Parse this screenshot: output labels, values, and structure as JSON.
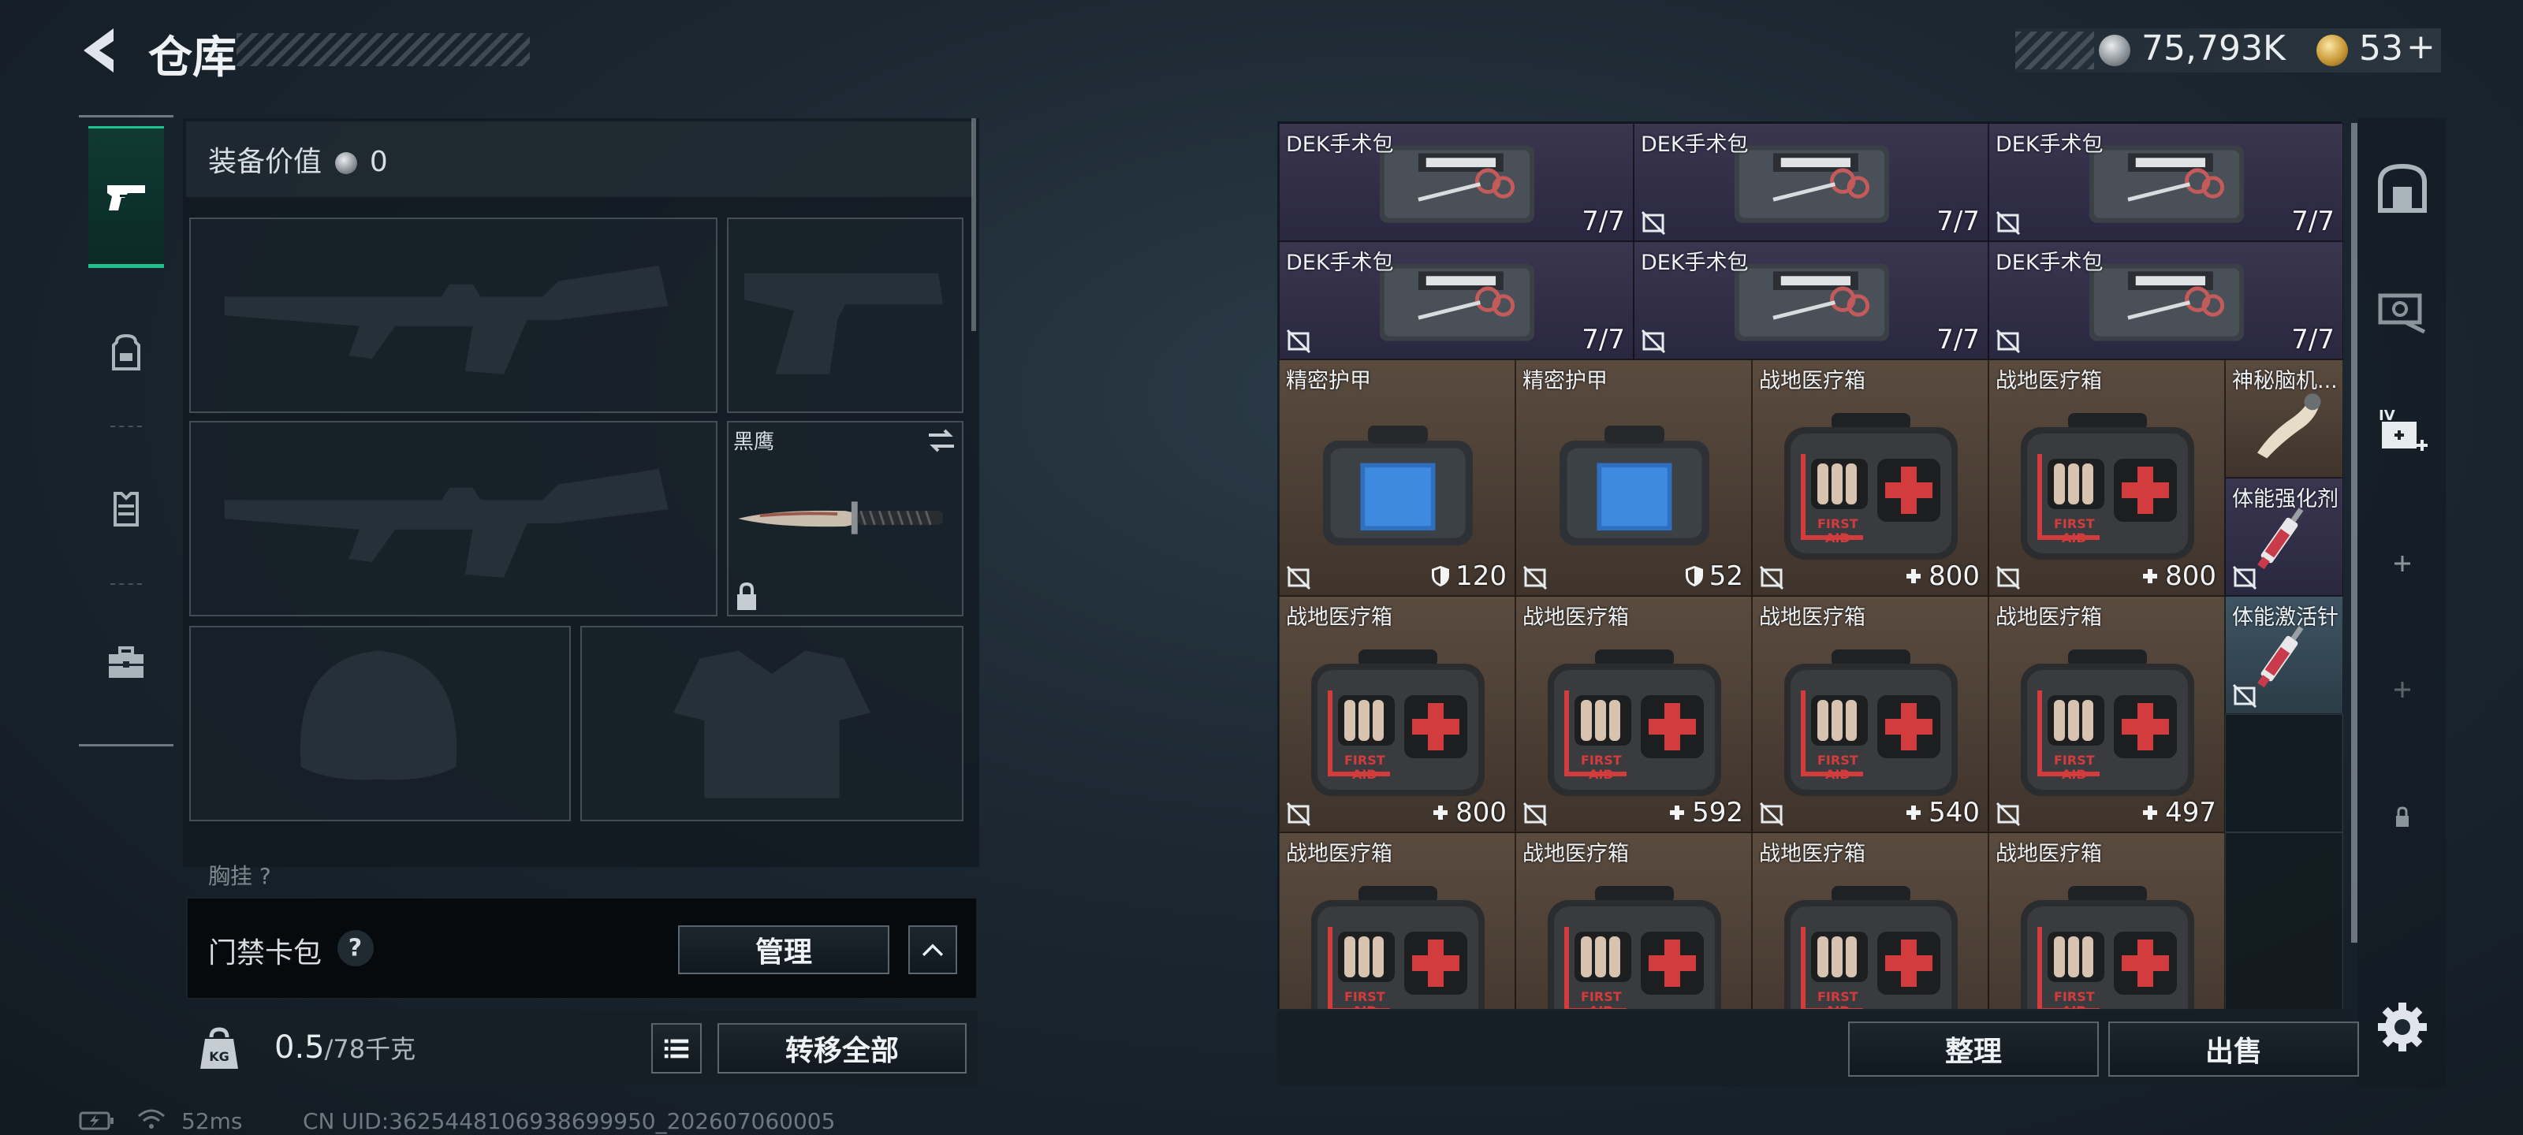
{
  "header": {
    "title": "仓库",
    "silver_amount": "75,793K",
    "gold_amount": "53",
    "gold_add": "+"
  },
  "tabs": [
    {
      "name": "weapons",
      "icon": "pistol-icon"
    },
    {
      "name": "backpack",
      "icon": "backpack-icon"
    },
    {
      "name": "vest",
      "icon": "vest-icon"
    },
    {
      "name": "case",
      "icon": "briefcase-icon"
    }
  ],
  "equipment": {
    "value_label": "装备价值",
    "value": "0",
    "knife_name": "黑鹰",
    "chest_label": "胸挂 ?"
  },
  "keycard": {
    "label": "门禁卡包",
    "help": "?",
    "manage_label": "管理"
  },
  "capacity": {
    "used": "0.5",
    "total": "/78千克",
    "transfer_all_label": "转移全部"
  },
  "status_bar": {
    "ping": "52ms",
    "uid": "CN UID:3625448106938699950_202607060005"
  },
  "grid_items": [
    {
      "name": "DEK手术包",
      "count": "7/7",
      "kind": "kit",
      "color": "purple",
      "lock": false
    },
    {
      "name": "DEK手术包",
      "count": "7/7",
      "kind": "kit",
      "color": "purple",
      "lock": true
    },
    {
      "name": "DEK手术包",
      "count": "7/7",
      "kind": "kit",
      "color": "purple",
      "lock": true
    },
    {
      "name": "DEK手术包",
      "count": "7/7",
      "kind": "kit",
      "color": "purple",
      "lock": true
    },
    {
      "name": "DEK手术包",
      "count": "7/7",
      "kind": "kit",
      "color": "purple",
      "lock": true
    },
    {
      "name": "DEK手术包",
      "count": "7/7",
      "kind": "kit",
      "color": "purple",
      "lock": true
    },
    {
      "name": "精密护甲",
      "count": "120",
      "stat": "shield",
      "kind": "armor",
      "color": "brown",
      "lock": true
    },
    {
      "name": "精密护甲",
      "count": "52",
      "stat": "shield",
      "kind": "armor",
      "color": "brown",
      "lock": true
    },
    {
      "name": "战地医疗箱",
      "count": "800",
      "stat": "plus",
      "kind": "medbox",
      "color": "brown",
      "lock": true
    },
    {
      "name": "战地医疗箱",
      "count": "800",
      "stat": "plus",
      "kind": "medbox",
      "color": "brown",
      "lock": true
    },
    {
      "name": "神秘脑机...",
      "count": "",
      "kind": "horn",
      "color": "brown",
      "lock": false
    },
    {
      "name": "体能强化剂",
      "count": "",
      "kind": "syringe",
      "color": "purple",
      "lock": true
    },
    {
      "name": "战地医疗箱",
      "count": "800",
      "stat": "plus",
      "kind": "medbox",
      "color": "brown",
      "lock": true
    },
    {
      "name": "战地医疗箱",
      "count": "592",
      "stat": "plus",
      "kind": "medbox",
      "color": "brown",
      "lock": true
    },
    {
      "name": "战地医疗箱",
      "count": "540",
      "stat": "plus",
      "kind": "medbox",
      "color": "brown",
      "lock": true
    },
    {
      "name": "战地医疗箱",
      "count": "497",
      "stat": "plus",
      "kind": "medbox",
      "color": "brown",
      "lock": true
    },
    {
      "name": "体能激活针",
      "count": "",
      "kind": "syringe",
      "color": "blue",
      "lock": true
    },
    {
      "name": "战地医疗箱",
      "count": "",
      "kind": "medbox",
      "color": "brown",
      "lock": false
    },
    {
      "name": "战地医疗箱",
      "count": "",
      "kind": "medbox",
      "color": "brown",
      "lock": false
    },
    {
      "name": "战地医疗箱",
      "count": "",
      "kind": "medbox",
      "color": "brown",
      "lock": false
    },
    {
      "name": "战地医疗箱",
      "count": "",
      "kind": "medbox",
      "color": "brown",
      "lock": false
    }
  ],
  "grid_actions": {
    "sort_label": "整理",
    "sell_label": "出售"
  },
  "right_tabs": [
    "safe-icon",
    "storage-icon",
    "add-storage-icon",
    "plus-icon",
    "plus-icon",
    "lock-icon"
  ],
  "colors": {
    "accent": "#1fbf8f",
    "purple_cell": "#3a3650",
    "brown_cell": "#5a4b3f",
    "blue_cell": "#3e5463"
  }
}
